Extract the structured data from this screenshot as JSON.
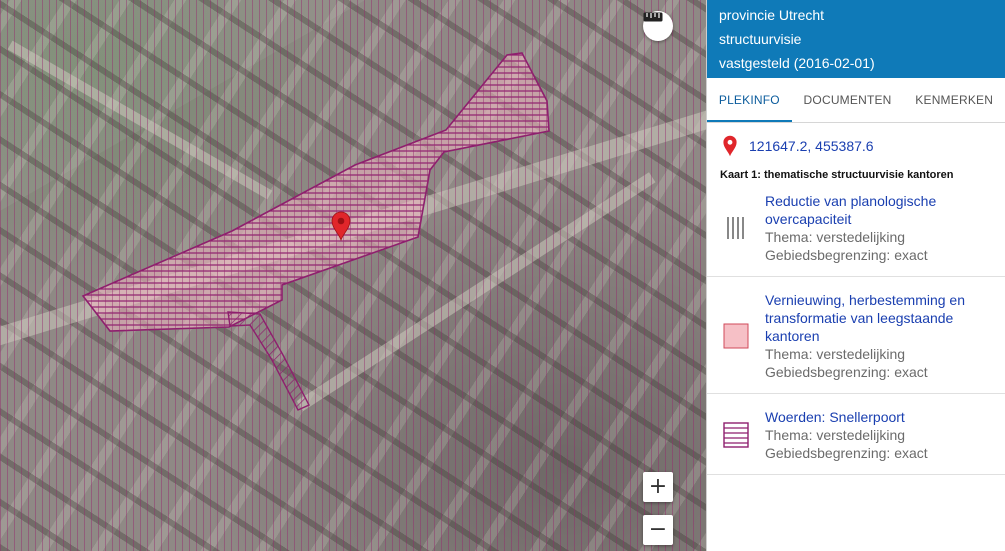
{
  "map": {
    "zoom_in_label": "+",
    "zoom_out_label": "−",
    "measure_icon": "ruler-icon",
    "marker_icon": "map-pin-icon",
    "colors": {
      "hatch": "#8e1f6e",
      "fill": "#f4b6c2"
    }
  },
  "panel": {
    "header": {
      "line1": "provincie Utrecht",
      "line2": "structuurvisie",
      "line3": "vastgesteld (2016-02-01)"
    },
    "tabs": [
      {
        "label": "PLEKINFO",
        "active": true
      },
      {
        "label": "DOCUMENTEN",
        "active": false
      },
      {
        "label": "KENMERKEN",
        "active": false
      }
    ],
    "location": {
      "coords": "121647.2, 455387.6",
      "icon": "map-pin-icon",
      "color": "#e0262b"
    },
    "map_title": "Kaart 1: thematische structuurvisie kantoren",
    "legend": [
      {
        "title": "Reductie van planologische overcapaciteit",
        "thema": "Thema: verstedelijking",
        "begrenzing": "Gebiedsbegrenzing: exact",
        "symbol": "vertical-lines"
      },
      {
        "title": "Vernieuwing, herbestemming en transformatie van leegstaande kantoren",
        "thema": "Thema: verstedelijking",
        "begrenzing": "Gebiedsbegrenzing: exact",
        "symbol": "pink-fill"
      },
      {
        "title": "Woerden: Snellerpoort",
        "thema": "Thema: verstedelijking",
        "begrenzing": "Gebiedsbegrenzing: exact",
        "symbol": "horizontal-hatch"
      }
    ]
  }
}
